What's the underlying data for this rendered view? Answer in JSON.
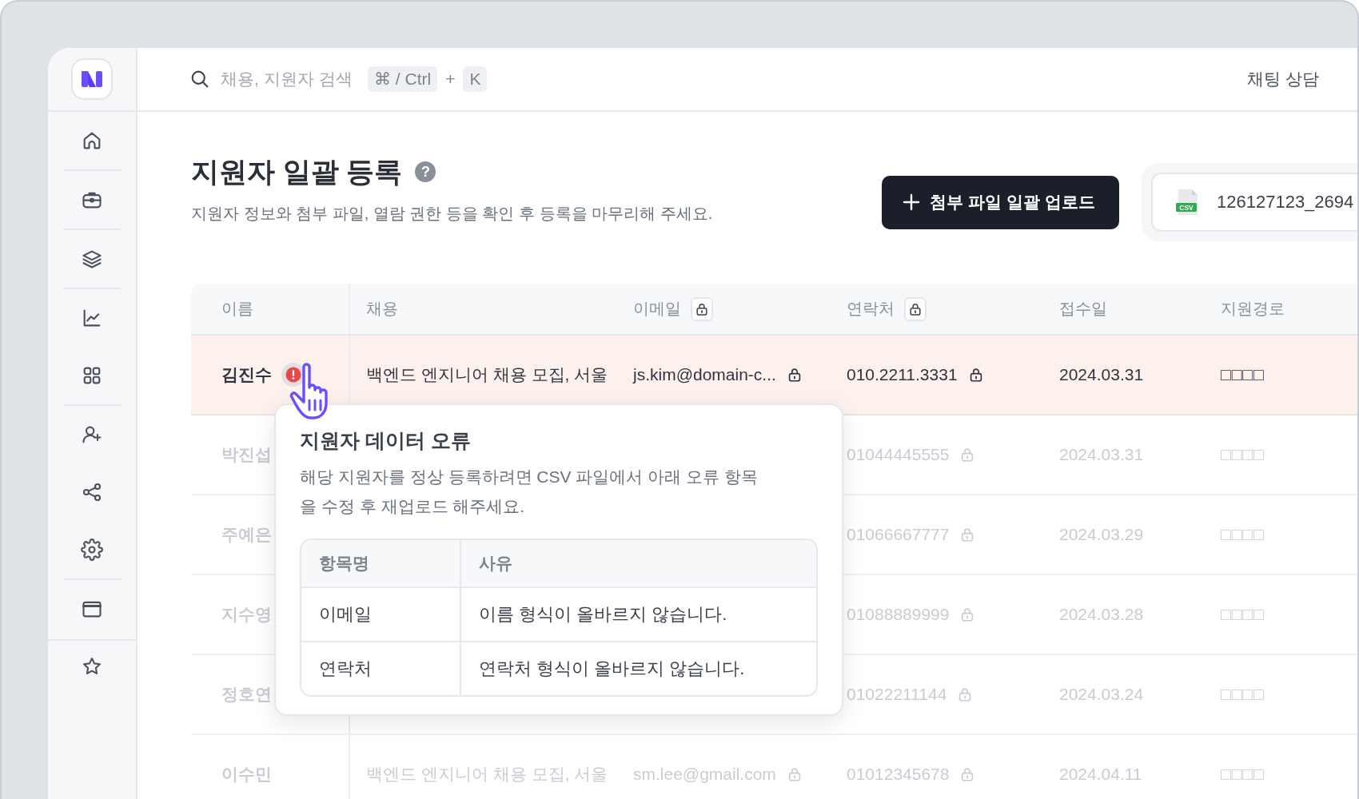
{
  "topbar": {
    "search": {
      "placeholder": "채용, 지원자 검색"
    },
    "shortcut": [
      {
        "kind": "key",
        "text": "⌘ / Ctrl"
      },
      {
        "kind": "plus",
        "text": "+"
      },
      {
        "kind": "key",
        "text": "K"
      }
    ],
    "chat_link": "채팅 상담"
  },
  "header": {
    "title": "지원자 일괄 등록",
    "help_mark": "?",
    "description": "지원자 정보와 첨부 파일, 열람 권한 등을 확인 후 등록을 마무리해 주세요.",
    "upload_button": "첨부 파일 일괄 업로드",
    "file": {
      "badge": "CSV",
      "name": "126127123_2694"
    }
  },
  "table": {
    "columns": [
      {
        "label": "이름",
        "locked": false
      },
      {
        "label": "채용",
        "locked": false
      },
      {
        "label": "이메일",
        "locked": true
      },
      {
        "label": "연락처",
        "locked": true
      },
      {
        "label": "접수일",
        "locked": false
      },
      {
        "label": "지원경로",
        "locked": false
      }
    ],
    "rows": [
      {
        "name": "김진수",
        "error": true,
        "dimmed": false,
        "recruitment": "백엔드 엔지니어 채용 모집, 서울",
        "email": "js.kim@domain-c...",
        "phone": "010.2211.3331",
        "date": "2024.03.31",
        "source": "□□□□"
      },
      {
        "name": "박진섭",
        "error": false,
        "dimmed": true,
        "phone": "01044445555",
        "date": "2024.03.31",
        "source": "□□□□"
      },
      {
        "name": "주예은",
        "error": false,
        "dimmed": true,
        "phone": "01066667777",
        "date": "2024.03.29",
        "source": "□□□□"
      },
      {
        "name": "지수영",
        "error": false,
        "dimmed": true,
        "phone": "01088889999",
        "date": "2024.03.28",
        "source": "□□□□"
      },
      {
        "name": "정호연",
        "error": false,
        "dimmed": true,
        "phone": "01022211144",
        "date": "2024.03.24",
        "source": "□□□□"
      },
      {
        "name": "이수민",
        "error": false,
        "dimmed": true,
        "recruitment": "백엔드 엔지니어 채용 모집, 서울",
        "email": "sm.lee@gmail.com",
        "phone": "01012345678",
        "date": "2024.04.11",
        "source": "□□□□"
      }
    ]
  },
  "tooltip": {
    "title": "지원자 데이터 오류",
    "description": "해당 지원자를 정상 등록하려면 CSV 파일에서 아래 오류 항목을 수정 후 재업로드 해주세요.",
    "columns": [
      "항목명",
      "사유"
    ],
    "rows": [
      {
        "field": "이메일",
        "reason": "이름 형식이 올바르지 않습니다."
      },
      {
        "field": "연락처",
        "reason": "연락처 형식이 올바르지 않습니다."
      }
    ]
  }
}
